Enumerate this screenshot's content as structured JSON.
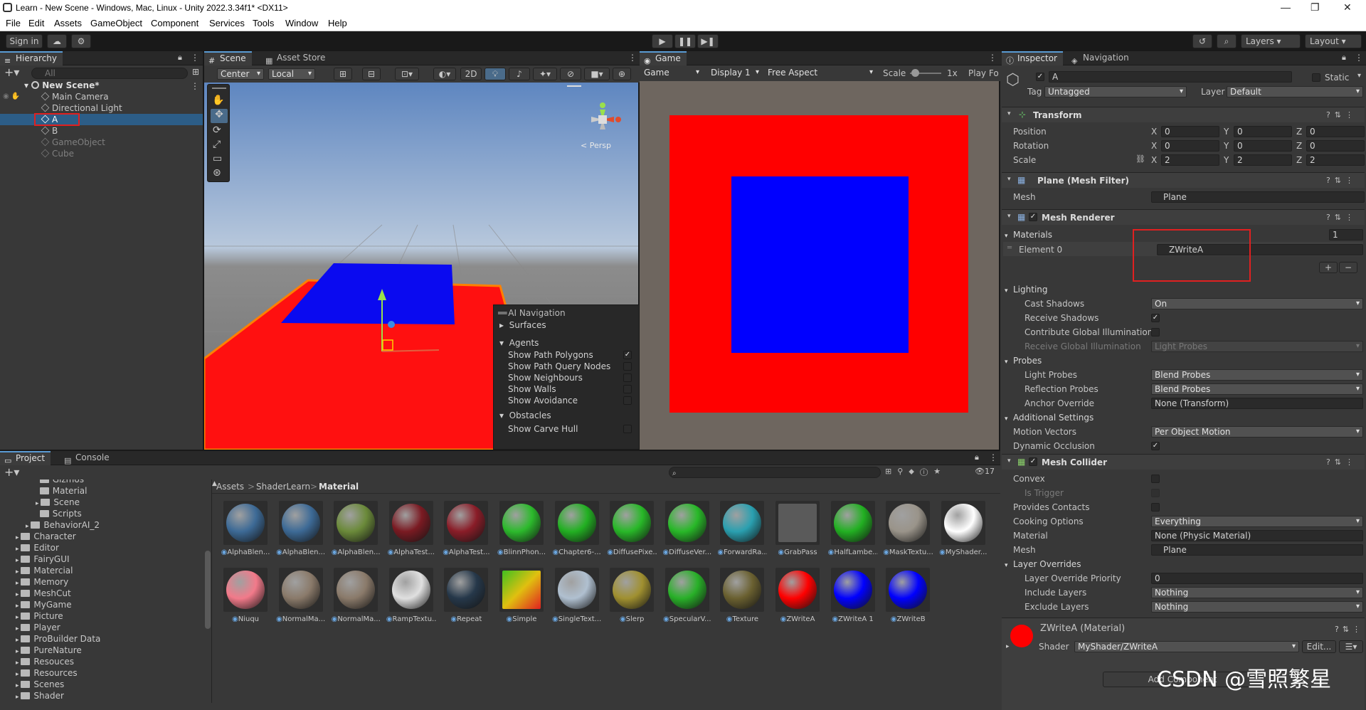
{
  "window": {
    "title": "Learn - New Scene - Windows, Mac, Linux - Unity 2022.3.34f1* <DX11>",
    "minimize": "—",
    "restore": "❐",
    "close": "✕"
  },
  "menu": [
    "File",
    "Edit",
    "Assets",
    "GameObject",
    "Component",
    "Services",
    "Tools",
    "Window",
    "Help"
  ],
  "toolbar": {
    "sign_in": "Sign in",
    "layers": "Layers",
    "layout": "Layout"
  },
  "hierarchy": {
    "tab": "Hierarchy",
    "search_placeholder": "All",
    "scene": "New Scene*",
    "items": [
      "Main Camera",
      "Directional Light",
      "A",
      "B",
      "GameObject",
      "Cube"
    ]
  },
  "scene_view": {
    "tabs": [
      "Scene",
      "Asset Store"
    ],
    "pivot": "Center",
    "space": "Local",
    "mode_2d": "2D",
    "gizmo_label": "< Persp"
  },
  "ai_nav": {
    "title": "AI Navigation",
    "surfaces": "Surfaces",
    "agents": "Agents",
    "agent_options": [
      {
        "label": "Show Path Polygons",
        "checked": true
      },
      {
        "label": "Show Path Query Nodes",
        "checked": false
      },
      {
        "label": "Show Neighbours",
        "checked": false
      },
      {
        "label": "Show Walls",
        "checked": false
      },
      {
        "label": "Show Avoidance",
        "checked": false
      }
    ],
    "obstacles": "Obstacles",
    "obstacle_options": [
      {
        "label": "Show Carve Hull",
        "checked": false
      }
    ]
  },
  "game_view": {
    "tab": "Game",
    "mode": "Game",
    "display": "Display 1",
    "aspect": "Free Aspect",
    "scale_label": "Scale",
    "scale_value": "1x",
    "play_focused": "Play Fo",
    "colors": {
      "outer": "#ff0000",
      "inner": "#0000ff",
      "bg": "#6e665f"
    }
  },
  "inspector": {
    "tabs": [
      "Inspector",
      "Navigation"
    ],
    "object_name": "A",
    "static_label": "Static",
    "tag_label": "Tag",
    "tag_value": "Untagged",
    "layer_label": "Layer",
    "layer_value": "Default",
    "transform": {
      "name": "Transform",
      "rows": [
        {
          "label": "Position",
          "x": "0",
          "y": "0",
          "z": "0"
        },
        {
          "label": "Rotation",
          "x": "0",
          "y": "0",
          "z": "0"
        },
        {
          "label": "Scale",
          "x": "2",
          "y": "2",
          "z": "2"
        }
      ]
    },
    "mesh_filter": {
      "name": "Plane (Mesh Filter)",
      "mesh_label": "Mesh",
      "mesh_value": "Plane"
    },
    "mesh_renderer": {
      "name": "Mesh Renderer",
      "materials_label": "Materials",
      "materials_count": "1",
      "element_label": "Element 0",
      "element_value": "ZWriteA",
      "lighting": "Lighting",
      "cast_shadows_label": "Cast Shadows",
      "cast_shadows_value": "On",
      "receive_shadows_label": "Receive Shadows",
      "contribute_gi_label": "Contribute Global Illumination",
      "receive_gi_label": "Receive Global Illumination",
      "receive_gi_value": "Light Probes",
      "probes": "Probes",
      "light_probes_label": "Light Probes",
      "light_probes_value": "Blend Probes",
      "reflection_probes_label": "Reflection Probes",
      "reflection_probes_value": "Blend Probes",
      "anchor_label": "Anchor Override",
      "anchor_value": "None (Transform)",
      "additional": "Additional Settings",
      "motion_label": "Motion Vectors",
      "motion_value": "Per Object Motion",
      "dynamic_occ_label": "Dynamic Occlusion"
    },
    "mesh_collider": {
      "name": "Mesh Collider",
      "convex_label": "Convex",
      "is_trigger_label": "Is Trigger",
      "provides_contacts_label": "Provides Contacts",
      "cooking_label": "Cooking Options",
      "cooking_value": "Everything",
      "material_label": "Material",
      "material_value": "None (Physic Material)",
      "mesh_label": "Mesh",
      "mesh_value": "Plane",
      "layer_overrides": "Layer Overrides",
      "priority_label": "Layer Override Priority",
      "priority_value": "0",
      "include_label": "Include Layers",
      "include_value": "Nothing",
      "exclude_label": "Exclude Layers",
      "exclude_value": "Nothing"
    },
    "material": {
      "name": "ZWriteA (Material)",
      "shader_label": "Shader",
      "shader_value": "MyShader/ZWriteA",
      "edit": "Edit...",
      "color": "#ff0000"
    },
    "add_component": "Add Component"
  },
  "project": {
    "tabs": [
      "Project",
      "Console"
    ],
    "count": "17",
    "breadcrumb": [
      "Assets",
      "ShaderLearn",
      "Material"
    ],
    "tree": [
      {
        "label": "Gizmos",
        "indent": 3
      },
      {
        "label": "Material",
        "indent": 3
      },
      {
        "label": "Scene",
        "indent": 3
      },
      {
        "label": "Scripts",
        "indent": 3
      },
      {
        "label": "BehaviorAI_2",
        "indent": 2
      },
      {
        "label": "Character",
        "indent": 1
      },
      {
        "label": "Editor",
        "indent": 1
      },
      {
        "label": "FairyGUI",
        "indent": 1
      },
      {
        "label": "Matercial",
        "indent": 1
      },
      {
        "label": "Memory",
        "indent": 1
      },
      {
        "label": "MeshCut",
        "indent": 1
      },
      {
        "label": "MyGame",
        "indent": 1
      },
      {
        "label": "Picture",
        "indent": 1
      },
      {
        "label": "Player",
        "indent": 1
      },
      {
        "label": "ProBuilder Data",
        "indent": 1
      },
      {
        "label": "PureNature",
        "indent": 1
      },
      {
        "label": "Resouces",
        "indent": 1
      },
      {
        "label": "Resources",
        "indent": 1
      },
      {
        "label": "Scenes",
        "indent": 1
      },
      {
        "label": "Shader",
        "indent": 1
      }
    ],
    "assets": [
      {
        "name": "AlphaBlen...",
        "color": "#3d6a96"
      },
      {
        "name": "AlphaBlen...",
        "color": "#3d6a96"
      },
      {
        "name": "AlphaBlen...",
        "color": "#6b8a3a"
      },
      {
        "name": "AlphaTest...",
        "color": "#7a1a22"
      },
      {
        "name": "AlphaTest...",
        "color": "#8a1d28"
      },
      {
        "name": "BlinnPhon...",
        "color": "#2cba2c"
      },
      {
        "name": "Chapter6-...",
        "color": "#22b022"
      },
      {
        "name": "DiffusePixe...",
        "color": "#28b828"
      },
      {
        "name": "DiffuseVer...",
        "color": "#28b828"
      },
      {
        "name": "ForwardRa...",
        "color": "#2aa0b0"
      },
      {
        "name": "GrabPass",
        "color": "#5a5a5a"
      },
      {
        "name": "HalfLambe...",
        "color": "#22b022"
      },
      {
        "name": "MaskTextu...",
        "color": "#9a948a"
      },
      {
        "name": "MyShader...",
        "color": "#ffffff"
      },
      {
        "name": "Niuqu",
        "color": "#f27a8a"
      },
      {
        "name": "NormalMa...",
        "color": "#8a7a6a"
      },
      {
        "name": "NormalMa...",
        "color": "#8a7a6a"
      },
      {
        "name": "RampTextu...",
        "color": "#e0e0e0"
      },
      {
        "name": "Repeat",
        "color": "#26384a"
      },
      {
        "name": "Simple",
        "color": "#d0b020"
      },
      {
        "name": "SingleText...",
        "color": "#b0c0d0"
      },
      {
        "name": "Slerp",
        "color": "#a09030"
      },
      {
        "name": "SpecularV...",
        "color": "#28b028"
      },
      {
        "name": "Texture",
        "color": "#6a6030"
      },
      {
        "name": "ZWriteA",
        "color": "#ff0000"
      },
      {
        "name": "ZWriteA 1",
        "color": "#0000ff"
      },
      {
        "name": "ZWriteB",
        "color": "#0000ff"
      }
    ]
  },
  "watermark": "CSDN @雪照繁星"
}
